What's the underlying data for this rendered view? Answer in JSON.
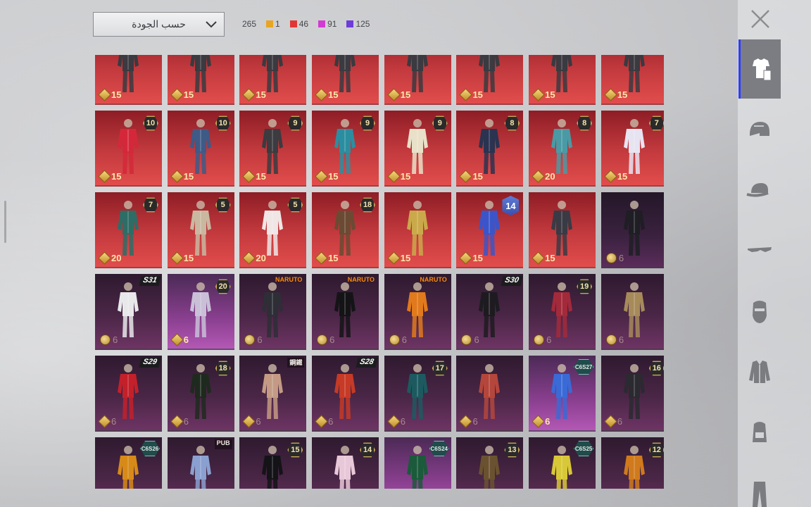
{
  "sort": {
    "label": "حسب الجودة"
  },
  "counts": [
    {
      "value": "265",
      "color": ""
    },
    {
      "value": "1",
      "color": "#e8a524"
    },
    {
      "value": "46",
      "color": "#e23636"
    },
    {
      "value": "91",
      "color": "#d23ad2"
    },
    {
      "value": "125",
      "color": "#6d3cd9"
    }
  ],
  "categories": [
    {
      "name": "outfit-icon",
      "active": true
    },
    {
      "name": "helmet-icon",
      "active": false
    },
    {
      "name": "cap-icon",
      "active": false
    },
    {
      "name": "sunglasses-icon",
      "active": false
    },
    {
      "name": "mask-icon",
      "active": false
    },
    {
      "name": "jacket-icon",
      "active": false
    },
    {
      "name": "backpack-icon",
      "active": false
    },
    {
      "name": "pants-icon",
      "active": false
    }
  ],
  "items": [
    {
      "bg": "red",
      "price": "15",
      "cur": "gem"
    },
    {
      "bg": "red",
      "price": "15",
      "cur": "gem"
    },
    {
      "bg": "red",
      "price": "15",
      "cur": "gem"
    },
    {
      "bg": "red",
      "price": "15",
      "cur": "gem"
    },
    {
      "bg": "red",
      "price": "15",
      "cur": "gem"
    },
    {
      "bg": "red",
      "price": "15",
      "cur": "gem"
    },
    {
      "bg": "red",
      "price": "15",
      "cur": "gem"
    },
    {
      "bg": "red",
      "price": "15",
      "cur": "gem"
    },
    {
      "bg": "red",
      "price": "15",
      "cur": "gem",
      "badge": "level",
      "badge_text": "10",
      "tint": "#d4283a"
    },
    {
      "bg": "red",
      "price": "15",
      "cur": "gem",
      "badge": "level",
      "badge_text": "10",
      "tint": "#3e5a86"
    },
    {
      "bg": "red",
      "price": "15",
      "cur": "gem",
      "badge": "level",
      "badge_text": "9",
      "tint": "#3b3b40"
    },
    {
      "bg": "red",
      "price": "15",
      "cur": "gem",
      "badge": "level",
      "badge_text": "9",
      "tint": "#2b8ea0"
    },
    {
      "bg": "red",
      "price": "15",
      "cur": "gem",
      "badge": "level",
      "badge_text": "9",
      "tint": "#e8e0c8"
    },
    {
      "bg": "red",
      "price": "15",
      "cur": "gem",
      "badge": "level",
      "badge_text": "8",
      "tint": "#2a3350"
    },
    {
      "bg": "red",
      "price": "20",
      "cur": "gem",
      "badge": "level",
      "badge_text": "8",
      "tint": "#4a9aa5"
    },
    {
      "bg": "red",
      "price": "15",
      "cur": "gem",
      "badge": "level",
      "badge_text": "7",
      "tint": "#e7e4f2"
    },
    {
      "bg": "red",
      "price": "20",
      "cur": "gem",
      "badge": "level",
      "badge_text": "7",
      "tint": "#2d6d66"
    },
    {
      "bg": "red",
      "price": "15",
      "cur": "gem",
      "badge": "level",
      "badge_text": "5",
      "tint": "#c9b7a0"
    },
    {
      "bg": "red",
      "price": "20",
      "cur": "gem",
      "badge": "level",
      "badge_text": "5",
      "tint": "#f0e6e6"
    },
    {
      "bg": "red",
      "price": "15",
      "cur": "gem",
      "badge": "level",
      "badge_text": "18",
      "tint": "#6b4a33"
    },
    {
      "bg": "red",
      "price": "15",
      "cur": "gem",
      "tint": "#caa94a"
    },
    {
      "bg": "red",
      "price": "15",
      "cur": "gem",
      "badge": "big",
      "badge_text": "14",
      "tint": "#3b55c9"
    },
    {
      "bg": "red",
      "price": "15",
      "cur": "gem",
      "tint": "#3a3a44"
    },
    {
      "bg": "dark",
      "price": "6",
      "cur": "coin",
      "muted": true,
      "tint": "#1e1e24"
    },
    {
      "bg": "purple",
      "price": "6",
      "cur": "coin",
      "muted": true,
      "badge": "season",
      "badge_text": "S31",
      "tint": "#e8e8ea"
    },
    {
      "bg": "bright",
      "price": "6",
      "cur": "gem",
      "badge": "level",
      "badge_text": "20",
      "tint": "#c9c0d8"
    },
    {
      "bg": "purple",
      "price": "6",
      "cur": "coin",
      "muted": true,
      "badge": "collab",
      "badge_text": "NARUTO",
      "tint": "#2e2e36"
    },
    {
      "bg": "purple",
      "price": "6",
      "cur": "coin",
      "muted": true,
      "badge": "collab",
      "badge_text": "NARUTO",
      "tint": "#141416"
    },
    {
      "bg": "purple",
      "price": "6",
      "cur": "coin",
      "muted": true,
      "badge": "collab",
      "badge_text": "NARUTO",
      "tint": "#e07a1c"
    },
    {
      "bg": "purple",
      "price": "6",
      "cur": "coin",
      "muted": true,
      "badge": "season",
      "badge_text": "S30",
      "tint": "#1d1b20"
    },
    {
      "bg": "purple",
      "price": "6",
      "cur": "coin",
      "muted": true,
      "badge": "level",
      "badge_text": "19",
      "tint": "#a32a3a"
    },
    {
      "bg": "purple",
      "price": "6",
      "cur": "coin",
      "muted": true,
      "tint": "#a68a5a"
    },
    {
      "bg": "purple",
      "price": "6",
      "cur": "gem",
      "muted": true,
      "badge": "season",
      "badge_text": "S29",
      "tint": "#c4202a"
    },
    {
      "bg": "purple",
      "price": "6",
      "cur": "gem",
      "muted": true,
      "badge": "level",
      "badge_text": "18",
      "tint": "#1e2a1e"
    },
    {
      "bg": "purple",
      "price": "6",
      "cur": "gem",
      "muted": true,
      "badge": "collab-dark",
      "badge_text": "鋼鐵",
      "tint": "#c49a84"
    },
    {
      "bg": "purple",
      "price": "6",
      "cur": "gem",
      "muted": true,
      "badge": "season",
      "badge_text": "S28",
      "tint": "#c63a26"
    },
    {
      "bg": "purple",
      "price": "6",
      "cur": "gem",
      "muted": true,
      "badge": "level",
      "badge_text": "17",
      "tint": "#1c5a60"
    },
    {
      "bg": "purple",
      "price": "6",
      "cur": "gem",
      "muted": true,
      "tint": "#b4463c"
    },
    {
      "bg": "bright",
      "price": "6",
      "cur": "gem",
      "badge": "cs",
      "badge_text": "C6S27",
      "tint": "#3a6ad6"
    },
    {
      "bg": "purple",
      "price": "6",
      "cur": "gem",
      "muted": true,
      "badge": "level",
      "badge_text": "16",
      "tint": "#2a2a30"
    },
    {
      "bg": "purple",
      "price": "6",
      "cur": "gem",
      "muted": true,
      "badge": "cs",
      "badge_text": "C6S26",
      "tint": "#d88a18"
    },
    {
      "bg": "purple",
      "price": "6",
      "cur": "gem",
      "muted": true,
      "badge": "collab-dark",
      "badge_text": "PUB",
      "tint": "#8aa0d0"
    },
    {
      "bg": "purple",
      "price": "6",
      "cur": "gem",
      "muted": true,
      "badge": "level",
      "badge_text": "15",
      "tint": "#141418"
    },
    {
      "bg": "purple",
      "price": "6",
      "cur": "gem",
      "muted": true,
      "badge": "level",
      "badge_text": "14",
      "tint": "#e8c8d8"
    },
    {
      "bg": "bright",
      "price": "6",
      "cur": "gem",
      "badge": "cs",
      "badge_text": "C6S24",
      "tint": "#1b5a3a"
    },
    {
      "bg": "purple",
      "price": "6",
      "cur": "gem",
      "muted": true,
      "badge": "level",
      "badge_text": "13",
      "tint": "#6a5230"
    },
    {
      "bg": "purple",
      "price": "6",
      "cur": "gem",
      "muted": true,
      "badge": "cs",
      "badge_text": "C6S25",
      "tint": "#d8c838"
    },
    {
      "bg": "purple",
      "price": "6",
      "cur": "gem",
      "muted": true,
      "badge": "level",
      "badge_text": "12",
      "tint": "#d07a1c"
    }
  ]
}
